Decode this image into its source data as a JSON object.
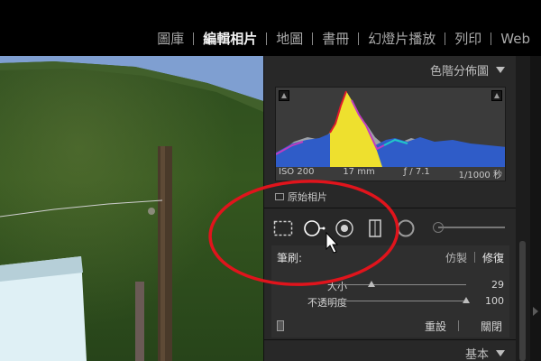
{
  "nav": {
    "modules": [
      {
        "label": "圖庫",
        "active": false
      },
      {
        "label": "編輯相片",
        "active": true
      },
      {
        "label": "地圖",
        "active": false
      },
      {
        "label": "書冊",
        "active": false
      },
      {
        "label": "幻燈片播放",
        "active": false
      },
      {
        "label": "列印",
        "active": false
      },
      {
        "label": "Web",
        "active": false
      }
    ]
  },
  "histogram": {
    "title": "色階分佈圖",
    "iso": "ISO 200",
    "focal": "17 mm",
    "aperture": "ƒ / 7.1",
    "shutter": "1/1000 秒",
    "original_label": "原始相片"
  },
  "tools": [
    {
      "name": "crop-tool-icon"
    },
    {
      "name": "spot-removal-tool-icon",
      "active": true
    },
    {
      "name": "red-eye-tool-icon"
    },
    {
      "name": "graduated-filter-tool-icon"
    },
    {
      "name": "radial-filter-tool-icon"
    },
    {
      "name": "adjustment-brush-tool-icon"
    }
  ],
  "brush": {
    "label": "筆刷:",
    "mode_clone": "仿製",
    "mode_heal": "修復",
    "active_mode": "修復",
    "size_label": "大小",
    "size_value": "29",
    "size_fraction": 0.29,
    "opacity_label": "不透明度",
    "opacity_value": "100",
    "opacity_fraction": 1.0,
    "reset_label": "重設",
    "close_label": "關閉"
  },
  "basic": {
    "title": "基本"
  },
  "colors": {
    "annotation": "#e0141c",
    "panel_bg": "#282828",
    "histogram_bg": "#3b3b3b"
  }
}
